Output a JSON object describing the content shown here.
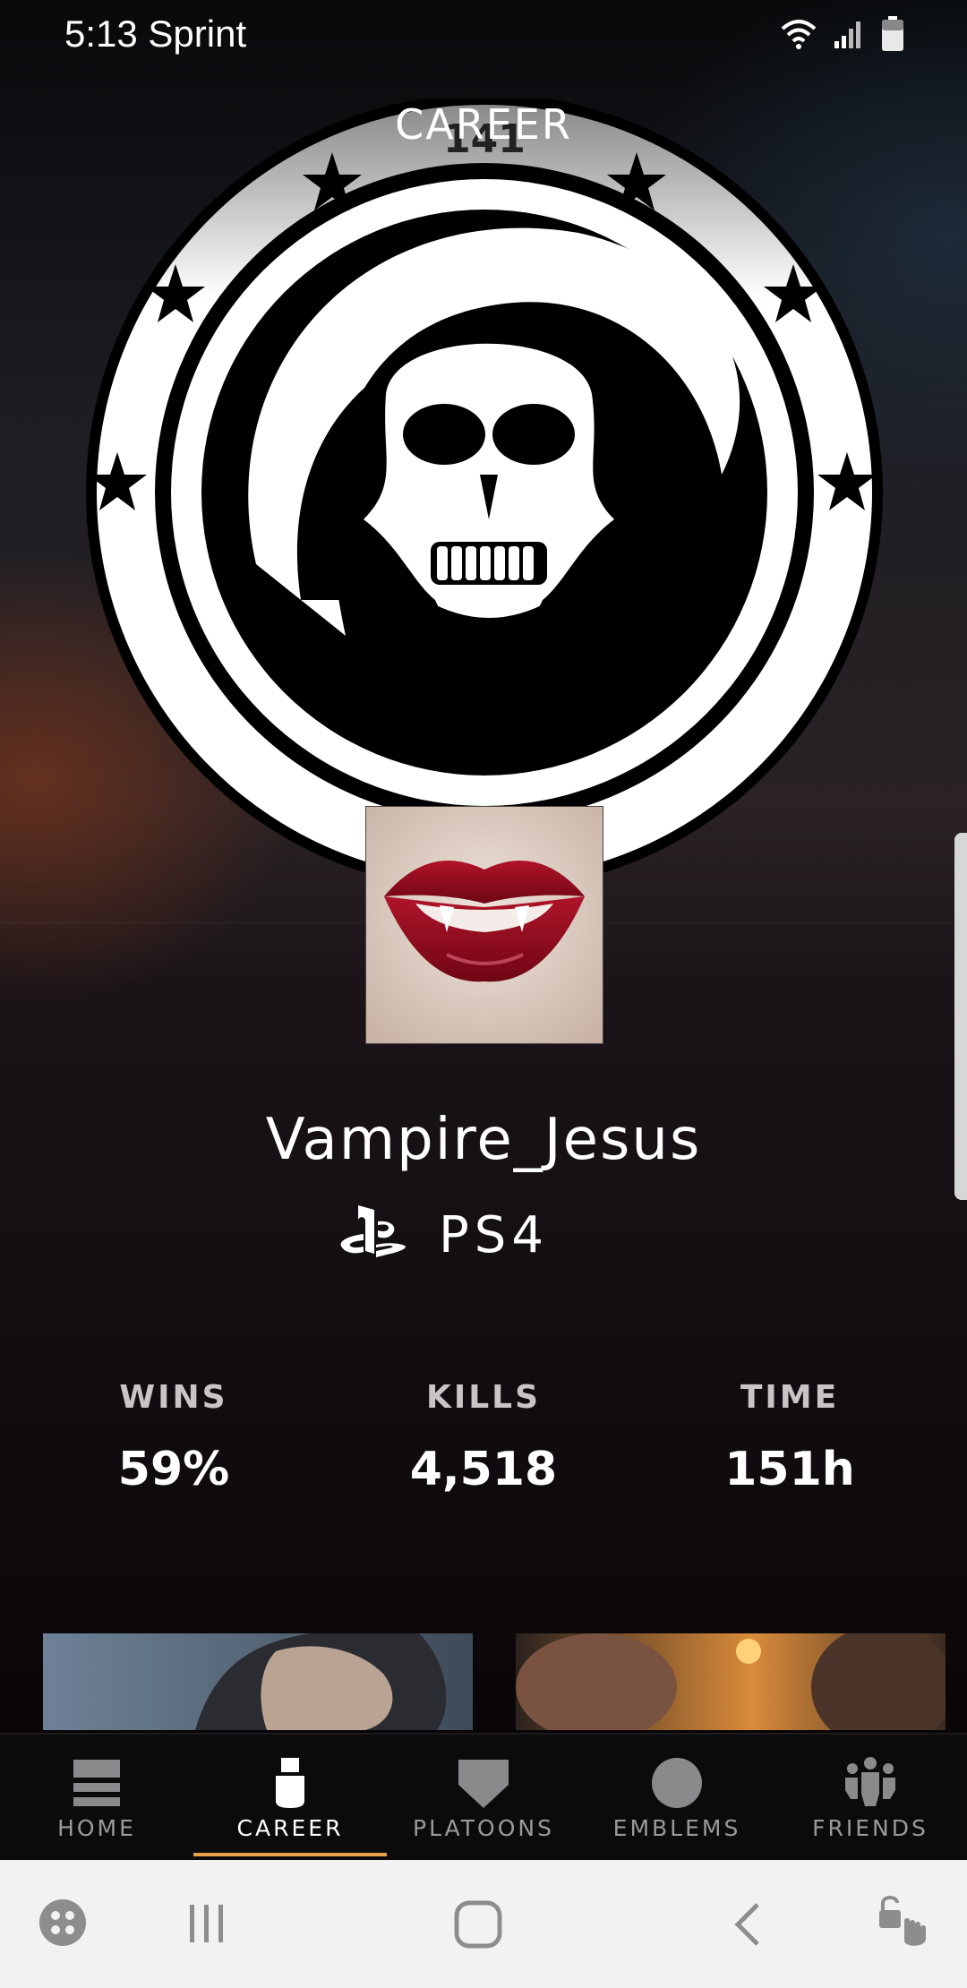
{
  "status_bar": {
    "time_carrier": "5:13 Sprint"
  },
  "header": {
    "title": "CAREER"
  },
  "profile": {
    "gamer_tag": "Vampire_Jesus",
    "platform_brand": "PS4"
  },
  "stats": [
    {
      "label": "WINS",
      "value": "59%"
    },
    {
      "label": "KILLS",
      "value": "4,518"
    },
    {
      "label": "TIME",
      "value": "151h"
    }
  ],
  "emblem": {
    "rank_text": "141"
  },
  "tabs": [
    {
      "label": "HOME",
      "icon": "home-icon"
    },
    {
      "label": "CAREER",
      "icon": "career-icon",
      "active": true
    },
    {
      "label": "PLATOONS",
      "icon": "platoons-icon"
    },
    {
      "label": "EMBLEMS",
      "icon": "emblems-icon"
    },
    {
      "label": "FRIENDS",
      "icon": "friends-icon"
    }
  ],
  "colors": {
    "accent": "#e8a046",
    "tab_inactive": "#9a9a9c"
  }
}
